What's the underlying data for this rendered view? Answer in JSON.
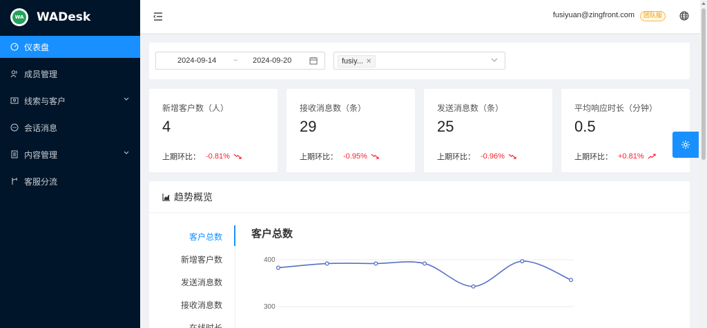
{
  "app": {
    "name": "WADesk",
    "logo_text": "WA"
  },
  "sidebar": {
    "items": [
      {
        "label": "仪表盘",
        "icon": "dashboard-icon",
        "active": true
      },
      {
        "label": "成员管理",
        "icon": "members-icon"
      },
      {
        "label": "线索与客户",
        "icon": "contacts-icon",
        "has_submenu": true
      },
      {
        "label": "会话消息",
        "icon": "chat-icon"
      },
      {
        "label": "内容管理",
        "icon": "content-icon",
        "has_submenu": true
      },
      {
        "label": "客服分流",
        "icon": "branch-icon"
      }
    ]
  },
  "header": {
    "user_email": "fusiyuan@zingfront.com",
    "plan_badge": "团队版"
  },
  "filters": {
    "date_start": "2024-09-14",
    "date_separator": "~",
    "date_end": "2024-09-20",
    "selected_tag": "fusiy..."
  },
  "stats": [
    {
      "label": "新增客户数（人）",
      "value": "4",
      "compare_label": "上期环比：",
      "compare_value": "-0.81%",
      "trend": "down"
    },
    {
      "label": "接收消息数（条）",
      "value": "29",
      "compare_label": "上期环比：",
      "compare_value": "-0.95%",
      "trend": "down"
    },
    {
      "label": "发送消息数（条）",
      "value": "25",
      "compare_label": "上期环比：",
      "compare_value": "-0.96%",
      "trend": "down"
    },
    {
      "label": "平均响应时长（分钟）",
      "value": "0.5",
      "compare_label": "上期环比：",
      "compare_value": "+0.81%",
      "trend": "up"
    }
  ],
  "trend": {
    "title": "趋势概览",
    "tabs": [
      "客户总数",
      "新增客户数",
      "发送消息数",
      "接收消息数",
      "在线时长"
    ],
    "active_tab": 0,
    "chart_title": "客户总数"
  },
  "chart_data": {
    "type": "line",
    "title": "客户总数",
    "y_ticks": [
      "400",
      "300"
    ],
    "y_range": [
      300,
      400
    ],
    "values": [
      383,
      392,
      392,
      392,
      343,
      397,
      357
    ],
    "color": "#5470c6"
  },
  "colors": {
    "accent": "#1890ff",
    "sidebar_bg": "#001529",
    "negative": "#f5222d"
  }
}
